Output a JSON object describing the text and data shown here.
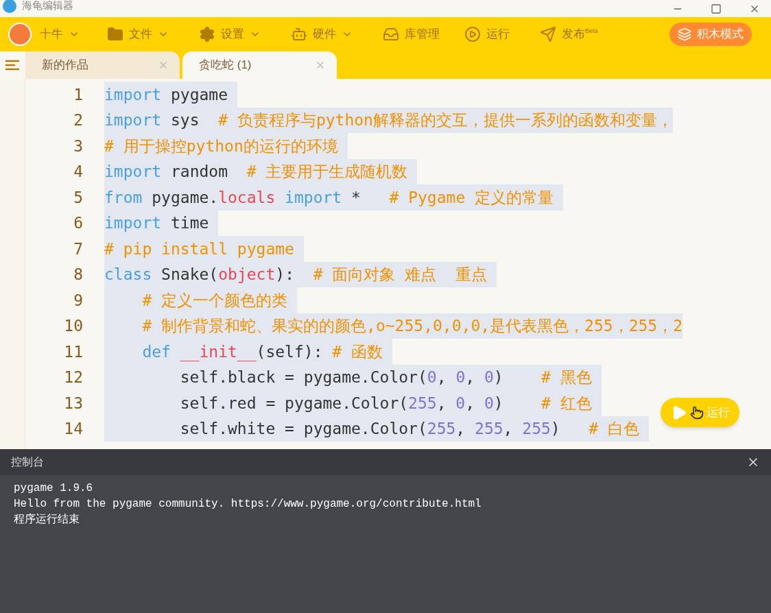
{
  "window": {
    "title": "海龟编辑器"
  },
  "toolbar": {
    "user": "十牛",
    "menus": [
      {
        "kind": "folder",
        "label": "文件",
        "dropdown": true
      },
      {
        "kind": "gear",
        "label": "设置",
        "dropdown": true
      },
      {
        "kind": "hardware",
        "label": "硬件",
        "dropdown": true
      },
      {
        "kind": "library",
        "label": "库管理",
        "dropdown": false
      },
      {
        "kind": "run",
        "label": "运行",
        "dropdown": false
      },
      {
        "kind": "publish",
        "label": "发布",
        "badge": "Beta",
        "dropdown": false
      }
    ],
    "mode_button": "积木模式"
  },
  "tabs": [
    {
      "label": "新的作品",
      "selected": false
    },
    {
      "label": "贪吃蛇 (1)",
      "selected": true
    }
  ],
  "editor": {
    "lines": [
      {
        "number": "1",
        "tokens": [
          {
            "kind": "kw",
            "text": "import"
          },
          {
            "kind": "plain",
            "text": " pygame "
          }
        ]
      },
      {
        "number": "2",
        "tokens": [
          {
            "kind": "kw",
            "text": "import"
          },
          {
            "kind": "plain",
            "text": " sys  "
          },
          {
            "kind": "comment",
            "text": "# 负责程序与python解释器的交互，提供一系列的函数和变量，"
          }
        ]
      },
      {
        "number": "3",
        "tokens": [
          {
            "kind": "comment",
            "text": "# 用于操控python的运行的环境 "
          }
        ]
      },
      {
        "number": "4",
        "tokens": [
          {
            "kind": "kw",
            "text": "import"
          },
          {
            "kind": "plain",
            "text": " random  "
          },
          {
            "kind": "comment",
            "text": "# 主要用于生成随机数 "
          }
        ]
      },
      {
        "number": "5",
        "tokens": [
          {
            "kind": "kw",
            "text": "from"
          },
          {
            "kind": "plain",
            "text": " pygame."
          },
          {
            "kind": "builtin",
            "text": "locals"
          },
          {
            "kind": "kw",
            "text": " import"
          },
          {
            "kind": "plain",
            "text": " *   "
          },
          {
            "kind": "comment",
            "text": "# Pygame 定义的常量 "
          }
        ]
      },
      {
        "number": "6",
        "tokens": [
          {
            "kind": "kw",
            "text": "import"
          },
          {
            "kind": "plain",
            "text": " time "
          }
        ]
      },
      {
        "number": "7",
        "tokens": [
          {
            "kind": "comment",
            "text": "# pip install pygame "
          }
        ]
      },
      {
        "number": "8",
        "tokens": [
          {
            "kind": "kw",
            "text": "class"
          },
          {
            "kind": "plain",
            "text": " Snake("
          },
          {
            "kind": "builtin",
            "text": "object"
          },
          {
            "kind": "plain",
            "text": "):  "
          },
          {
            "kind": "comment",
            "text": "# 面向对象 难点  重点 "
          }
        ]
      },
      {
        "number": "9",
        "tokens": [
          {
            "kind": "comment",
            "text": "    # 定义一个颜色的类 "
          }
        ]
      },
      {
        "number": "10",
        "tokens": [
          {
            "kind": "comment",
            "text": "    # 制作背景和蛇、果实的的颜色,o~255,0,0,0,是代表黑色，255，255，2"
          }
        ]
      },
      {
        "number": "11",
        "tokens": [
          {
            "kind": "kw",
            "text": "    def"
          },
          {
            "kind": "builtin",
            "text": " __init__"
          },
          {
            "kind": "plain",
            "text": "(self): "
          },
          {
            "kind": "comment",
            "text": "# 函数 "
          }
        ]
      },
      {
        "number": "12",
        "tokens": [
          {
            "kind": "plain",
            "text": "        self.black = pygame.Color("
          },
          {
            "kind": "number",
            "text": "0"
          },
          {
            "kind": "plain",
            "text": ", "
          },
          {
            "kind": "number",
            "text": "0"
          },
          {
            "kind": "plain",
            "text": ", "
          },
          {
            "kind": "number",
            "text": "0"
          },
          {
            "kind": "plain",
            "text": ")    "
          },
          {
            "kind": "comment",
            "text": "# 黑色 "
          }
        ]
      },
      {
        "number": "13",
        "tokens": [
          {
            "kind": "plain",
            "text": "        self.red = pygame.Color("
          },
          {
            "kind": "number",
            "text": "255"
          },
          {
            "kind": "plain",
            "text": ", "
          },
          {
            "kind": "number",
            "text": "0"
          },
          {
            "kind": "plain",
            "text": ", "
          },
          {
            "kind": "number",
            "text": "0"
          },
          {
            "kind": "plain",
            "text": ")    "
          },
          {
            "kind": "comment",
            "text": "# 红色 "
          }
        ]
      },
      {
        "number": "14",
        "tokens": [
          {
            "kind": "plain",
            "text": "        self.white = pygame.Color("
          },
          {
            "kind": "number",
            "text": "255"
          },
          {
            "kind": "plain",
            "text": ", "
          },
          {
            "kind": "number",
            "text": "255"
          },
          {
            "kind": "plain",
            "text": ", "
          },
          {
            "kind": "number",
            "text": "255"
          },
          {
            "kind": "plain",
            "text": ")   "
          },
          {
            "kind": "comment",
            "text": "# 白色 "
          }
        ]
      }
    ]
  },
  "run_button": "运行",
  "console": {
    "title": "控制台",
    "lines": [
      "pygame 1.9.6",
      "Hello from the pygame community. https://www.pygame.org/contribute.html",
      "程序运行结束"
    ]
  }
}
